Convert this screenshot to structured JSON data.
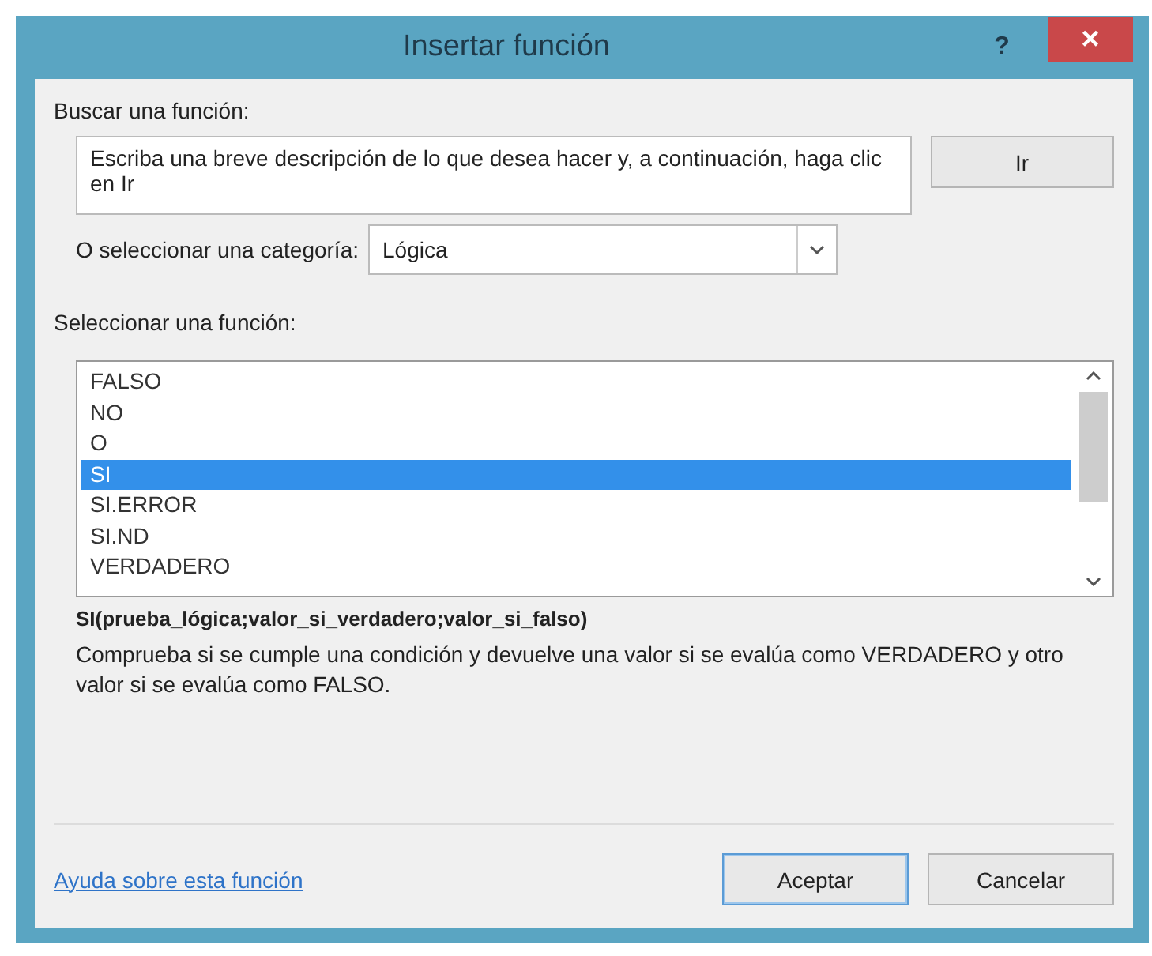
{
  "window": {
    "title": "Insertar función",
    "help": "?",
    "close": "×"
  },
  "search": {
    "label": "Buscar una función:",
    "value": "Escriba una breve descripción de lo que desea hacer y, a continuación, haga clic en Ir",
    "button": "Ir"
  },
  "category": {
    "label": "O seleccionar una categoría:",
    "value": "Lógica"
  },
  "functions": {
    "label": "Seleccionar una función:",
    "items": [
      {
        "label": "FALSO",
        "selected": false
      },
      {
        "label": "NO",
        "selected": false
      },
      {
        "label": "O",
        "selected": false
      },
      {
        "label": "SI",
        "selected": true
      },
      {
        "label": "SI.ERROR",
        "selected": false
      },
      {
        "label": "SI.ND",
        "selected": false
      },
      {
        "label": "VERDADERO",
        "selected": false
      }
    ]
  },
  "signature": "SI(prueba_lógica;valor_si_verdadero;valor_si_falso)",
  "description": "Comprueba si se cumple una condición y devuelve una valor si se evalúa como VERDADERO y otro valor si se evalúa como FALSO.",
  "help_link": "Ayuda sobre esta función",
  "buttons": [
    {
      "label": "Aceptar",
      "default": true
    },
    {
      "label": "Cancelar",
      "default": false
    }
  ]
}
